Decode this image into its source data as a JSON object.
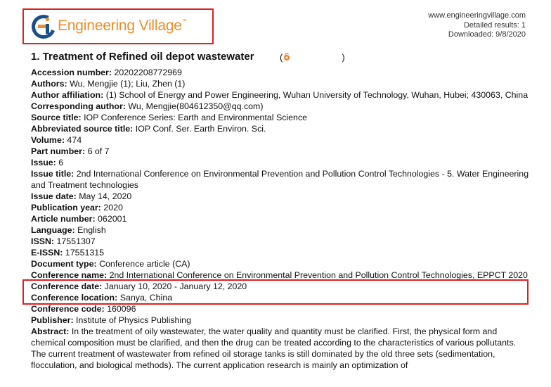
{
  "header": {
    "brand": "Engineering Village",
    "brand_tm": "™",
    "site": "www.engineeringvillage.com",
    "detailed_results": "Detailed results: 1",
    "downloaded": "Downloaded: 9/8/2020"
  },
  "record": {
    "title": "1. Treatment of Refined oil depot wastewater",
    "title_paren_open": "(",
    "title_paren_close": ")",
    "fields": [
      {
        "label": "Accession number:",
        "value": "20202208772969"
      },
      {
        "label": "Authors:",
        "value": "Wu, Mengjie (1); Liu, Zhen (1)"
      },
      {
        "label": "Author affiliation:",
        "value": "(1) School of Energy and Power Engineering, Wuhan University of Technology, Wuhan, Hubei; 430063, China"
      },
      {
        "label": "Corresponding author:",
        "value": "Wu, Mengjie(804612350@qq.com)"
      },
      {
        "label": "Source title:",
        "value": "IOP Conference Series: Earth and Environmental Science"
      },
      {
        "label": "Abbreviated source title:",
        "value": "IOP Conf. Ser. Earth Environ. Sci."
      },
      {
        "label": "Volume:",
        "value": "474"
      },
      {
        "label": "Part number:",
        "value": "6 of 7"
      },
      {
        "label": "Issue:",
        "value": "6"
      },
      {
        "label": "Issue title:",
        "value": "2nd International Conference on Environmental Prevention and Pollution Control Technologies - 5. Water Engineering and Treatment technologies"
      },
      {
        "label": "Issue date:",
        "value": "May 14, 2020"
      },
      {
        "label": "Publication year:",
        "value": "2020"
      },
      {
        "label": "Article number:",
        "value": "062001"
      },
      {
        "label": "Language:",
        "value": "English"
      },
      {
        "label": "ISSN:",
        "value": "17551307"
      },
      {
        "label": "E-ISSN:",
        "value": "17551315"
      },
      {
        "label": "Document type:",
        "value": "Conference article (CA)"
      },
      {
        "label": "Conference name:",
        "value": "2nd International Conference on Environmental Prevention and Pollution Control Technologies, EPPCT 2020"
      },
      {
        "label": "Conference date:",
        "value": "January 10, 2020 - January 12, 2020"
      },
      {
        "label": "Conference location:",
        "value": "Sanya, China"
      },
      {
        "label": "Conference code:",
        "value": "160096"
      },
      {
        "label": "Publisher:",
        "value": "Institute of Physics Publishing"
      },
      {
        "label": "Abstract:",
        "value": "In the treatment of oily wastewater, the water quality and quantity must be clarified. First, the physical form and chemical composition must be clarified, and then the drug can be treated according to the characteristics of various pollutants. The current treatment of wastewater from refined oil storage tanks is still dominated by the old three sets (sedimentation, flocculation, and biological methods). The current application research is mainly an optimization of"
      }
    ]
  },
  "colors": {
    "brand_orange": "#f28c28",
    "brand_blue": "#1a4f8b",
    "highlight_red": "#e02020"
  },
  "icons": {
    "logo": "engineering-village-logo-icon",
    "open_access": "open-access-icon"
  }
}
